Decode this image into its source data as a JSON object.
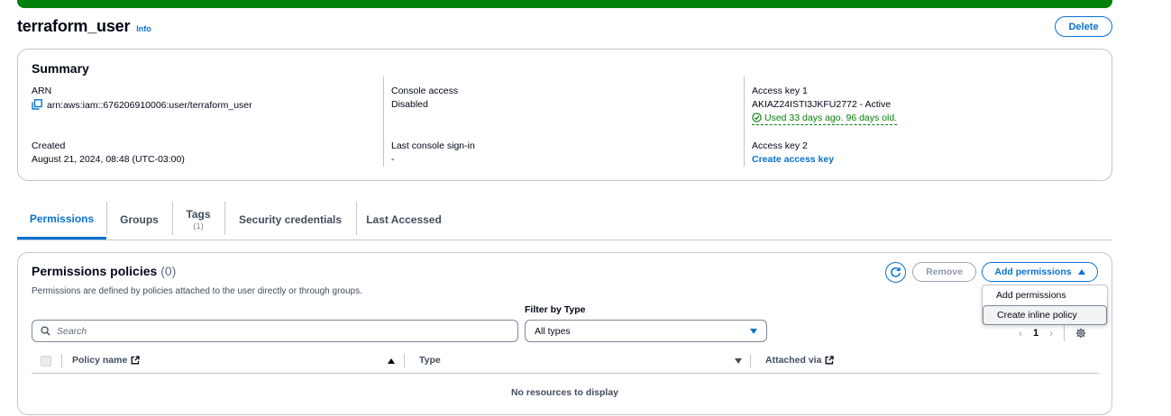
{
  "header": {
    "title": "terraform_user",
    "info_label": "Info",
    "delete_label": "Delete"
  },
  "summary": {
    "title": "Summary",
    "arn": {
      "label": "ARN",
      "value": "arn:aws:iam::676206910006:user/terraform_user"
    },
    "created": {
      "label": "Created",
      "value": "August 21, 2024, 08:48 (UTC-03:00)"
    },
    "console_access": {
      "label": "Console access",
      "value": "Disabled"
    },
    "last_signin": {
      "label": "Last console sign-in",
      "value": "-"
    },
    "access_key_1": {
      "label": "Access key 1",
      "value": "AKIAZ24ISTI3JKFU2772 - Active",
      "status": "Used 33 days ago. 96 days old."
    },
    "access_key_2": {
      "label": "Access key 2",
      "link": "Create access key"
    }
  },
  "tabs": [
    {
      "label": "Permissions",
      "count": ""
    },
    {
      "label": "Groups",
      "count": ""
    },
    {
      "label": "Tags",
      "count": "(1)"
    },
    {
      "label": "Security credentials",
      "count": ""
    },
    {
      "label": "Last Accessed",
      "count": ""
    }
  ],
  "permissions": {
    "title": "Permissions policies",
    "count": "(0)",
    "description": "Permissions are defined by policies attached to the user directly or through groups.",
    "remove_label": "Remove",
    "add_label": "Add permissions",
    "dropdown": [
      "Add permissions",
      "Create inline policy"
    ],
    "filter_label": "Filter by Type",
    "search_placeholder": "Search",
    "filter_value": "All types",
    "page": "1",
    "columns": [
      "Policy name",
      "Type",
      "Attached via"
    ],
    "empty_message": "No resources to display"
  },
  "colors": {
    "accent": "#0972d3",
    "success": "#037f0c",
    "border": "#c6c6cd"
  }
}
